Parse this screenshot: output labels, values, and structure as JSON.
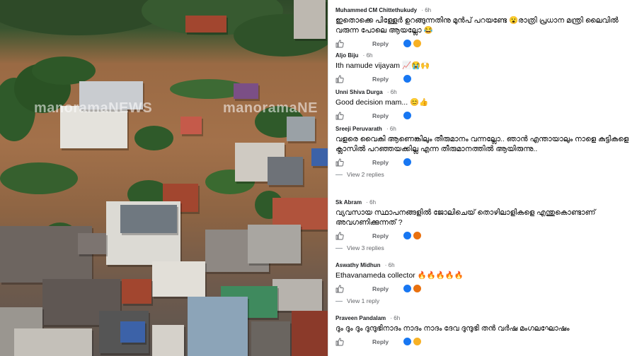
{
  "photo": {
    "watermark_1": "manoramaNEWS",
    "watermark_2": "manoramaNE"
  },
  "actions": {
    "reply_label": "Reply"
  },
  "comments": [
    {
      "author": "Muhammed CM Chittethukudy",
      "time": "6h",
      "text": "ഇതൊക്കെ പിള്ളേർ ഉറങ്ങുന്നതിനു മുൻപ് പറയണ്ടേ 😮രാത്രി പ്രധാന മന്ത്രി ലൈവിൽ വരുന്ന പോലെ ആയല്ലോ 😂",
      "reactions": [
        "like",
        "haha"
      ]
    },
    {
      "author": "Aljo Biju",
      "time": "6h",
      "text": "Ith namude vijayam 📈😭🙌",
      "reactions": [
        "like"
      ]
    },
    {
      "author": "Unni Shiva Durga",
      "time": "6h",
      "text": "Good decision mam... 😊👍",
      "reactions": [
        "like"
      ]
    },
    {
      "author": "Sreeji Peruvarath",
      "time": "6h",
      "text": "വളരെ വൈകി ആണെങ്കിലും തീരുമാനം വന്നല്ലോ.. ഞാൻ എന്തായാലും നാളെ കുട്ടികളെ ക്ലാസിൽ പറഞ്ഞയക്കില്ല എന്ന തീരുമാനത്തിൽ ആയിരുന്നു..",
      "reactions": [
        "like"
      ],
      "replies": "View 2 replies"
    },
    {
      "author": "Sk Abram",
      "time": "6h",
      "text": "വ്യവസായ സ്ഥാപനങ്ങളിൽ ജോലിചെയ്‌ തൊഴിലാളികളെ എന്തുകൊണ്ടാണ് അവഗണിക്കുന്നത് ?",
      "reactions": [
        "like",
        "angry"
      ],
      "replies": "View 3 replies"
    },
    {
      "author": "Aswathy Midhun",
      "time": "6h",
      "text": "Ethavanameda collector 🔥🔥🔥🔥🔥",
      "reactions": [
        "like",
        "angry"
      ],
      "replies": "View 1 reply"
    },
    {
      "author": "Praveen Pandalam",
      "time": "6h",
      "text": "ദും ദും ദും ദുന്ദുഭിനാദം നാദം നാദം ദേവ ദുന്ദുഭി തൻ വർഷ മംഗലഘോഷം",
      "reactions": [
        "like",
        "haha"
      ]
    }
  ]
}
